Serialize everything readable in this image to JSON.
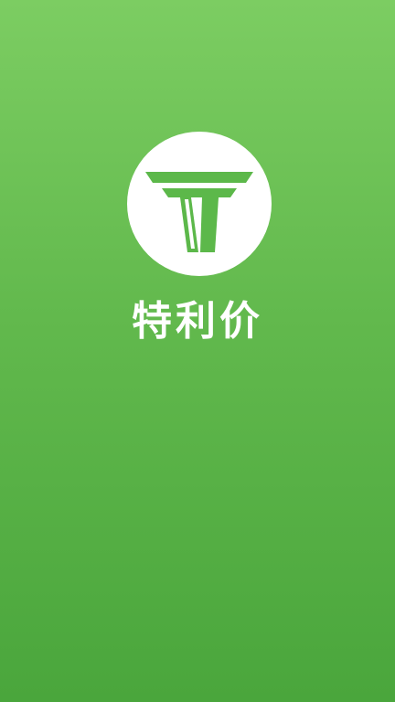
{
  "splash": {
    "app_name": "特利价",
    "logo_icon": "t-letter-logo-icon",
    "background_top": "#7ccd62",
    "background_bottom": "#4aa63c",
    "logo_color": "#5cb84a"
  }
}
